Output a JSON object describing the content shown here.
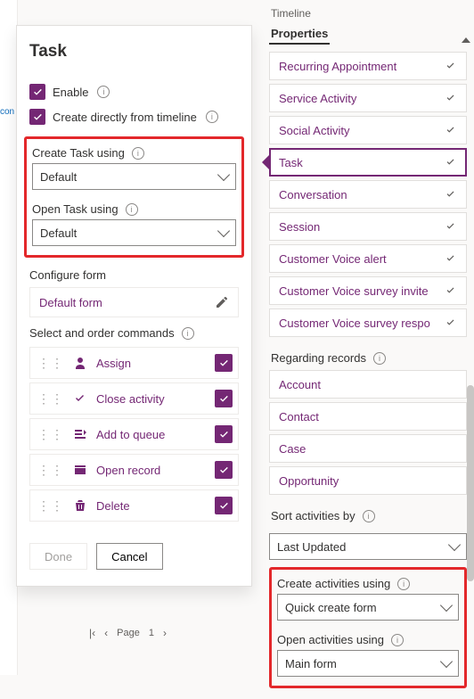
{
  "task_panel": {
    "title": "Task",
    "enable_label": "Enable",
    "create_from_timeline_label": "Create directly from timeline",
    "create_using_label": "Create Task using",
    "create_using_value": "Default",
    "open_using_label": "Open Task using",
    "open_using_value": "Default",
    "configure_form_label": "Configure form",
    "configure_form_value": "Default form",
    "commands_label": "Select and order commands",
    "commands": [
      {
        "label": "Assign",
        "icon": "person"
      },
      {
        "label": "Close activity",
        "icon": "check"
      },
      {
        "label": "Add to queue",
        "icon": "queue"
      },
      {
        "label": "Open record",
        "icon": "open"
      },
      {
        "label": "Delete",
        "icon": "trash"
      }
    ],
    "done_label": "Done",
    "cancel_label": "Cancel"
  },
  "pager": {
    "page_label": "Page",
    "page_number": "1"
  },
  "right": {
    "tab_timeline": "Timeline",
    "tab_properties": "Properties",
    "activities": [
      "Recurring Appointment",
      "Service Activity",
      "Social Activity",
      "Task",
      "Conversation",
      "Session",
      "Customer Voice alert",
      "Customer Voice survey invite",
      "Customer Voice survey respo"
    ],
    "selected_activity_index": 3,
    "regarding_label": "Regarding records",
    "regarding": [
      "Account",
      "Contact",
      "Case",
      "Opportunity"
    ],
    "sort_label": "Sort activities by",
    "sort_value": "Last Updated",
    "create_activities_label": "Create activities using",
    "create_activities_value": "Quick create form",
    "open_activities_label": "Open activities using",
    "open_activities_value": "Main form"
  },
  "left_strip": {
    "link_fragment": "con"
  }
}
